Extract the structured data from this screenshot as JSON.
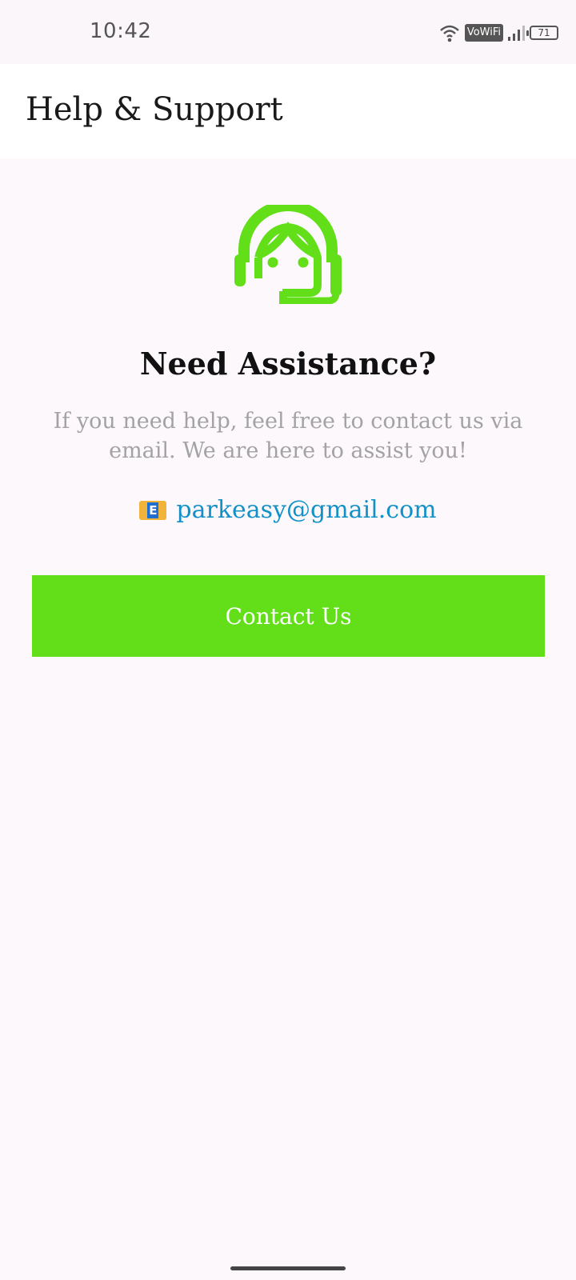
{
  "status_bar": {
    "time": "10:42",
    "vowifi_label": "VoWiFi",
    "battery_level": "71",
    "icons": [
      "wifi-icon",
      "signal-icon",
      "battery-icon"
    ]
  },
  "app_bar": {
    "title": "Help & Support"
  },
  "main": {
    "icon": "customer-support-headset-icon",
    "heading": "Need Assistance?",
    "description": "If you need help, feel free to contact us via email. We are here to assist you!",
    "email_icon": "e-mail-envelope-icon",
    "email_icon_letter": "E",
    "email": "parkeasy@gmail.com",
    "contact_button_label": "Contact Us"
  },
  "colors": {
    "accent": "#63df1a",
    "link": "#1191c8",
    "description_text": "#a3a3a3",
    "background": "#fdf8fc"
  }
}
